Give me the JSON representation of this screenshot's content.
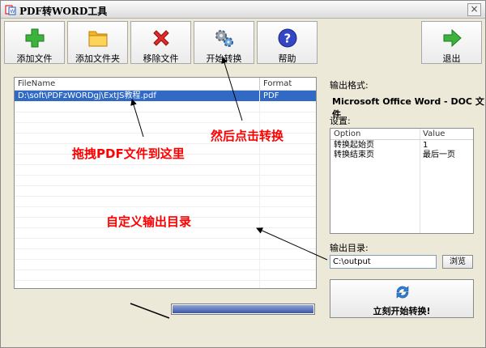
{
  "window": {
    "title": "PDF转WORD工具"
  },
  "toolbar": {
    "add_file": "添加文件",
    "add_folder": "添加文件夹",
    "remove_file": "移除文件",
    "start_convert": "开始转换",
    "help": "帮助",
    "exit": "退出"
  },
  "filelist": {
    "columns": [
      "FileName",
      "Format"
    ],
    "rows": [
      {
        "filename": "D:\\soft\\PDFzWORDgj\\ExtJS教程.pdf",
        "format": "PDF",
        "selected": true
      }
    ]
  },
  "progress": {
    "value": 1.0
  },
  "settings": {
    "format_label": "输出格式:",
    "format_value": "Microsoft Office Word - DOC 文件",
    "settings_label": "设置:",
    "option_header": "Option",
    "value_header": "Value",
    "options": [
      {
        "key": "转换起始页",
        "value": "1"
      },
      {
        "key": "转换结束页",
        "value": "最后一页"
      }
    ],
    "output_dir_label": "输出目录:",
    "output_dir_value": "C:\\output",
    "browse_label": "浏览",
    "start_now_label": "立刻开始转换!"
  },
  "annotations": {
    "drag_here": "拖拽PDF文件到这里",
    "then_click": "然后点击转换",
    "custom_output": "自定义输出目录"
  },
  "colors": {
    "annotation": "#ff0000",
    "selection": "#316ac5"
  },
  "icons": {
    "add_file": "plus-icon",
    "add_folder": "folder-icon",
    "remove_file": "red-x-icon",
    "start_convert": "gears-icon",
    "help": "help-icon",
    "exit": "arrow-right-icon",
    "start_now": "refresh-icon"
  }
}
